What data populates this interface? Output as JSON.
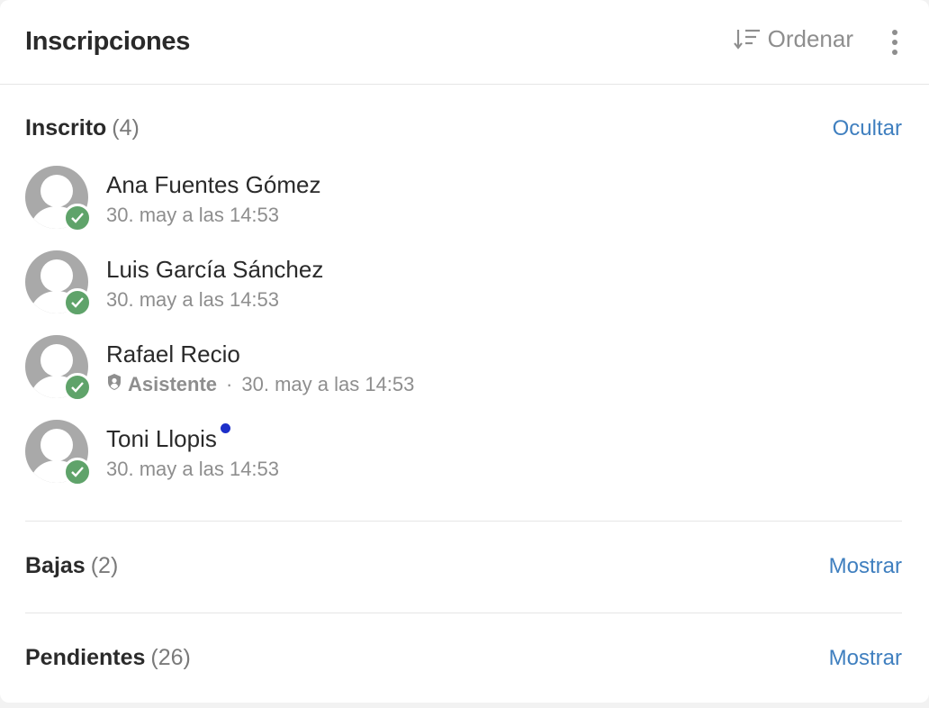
{
  "header": {
    "title": "Inscripciones",
    "sort_label": "Ordenar",
    "sort_icon": "sort-descending-icon",
    "menu_icon": "more-vertical-icon"
  },
  "sections": {
    "enrolled": {
      "title": "Inscrito",
      "count": "(4)",
      "action": "Ocultar",
      "members": [
        {
          "name": "Ana Fuentes Gómez",
          "date": "30. may a las 14:53"
        },
        {
          "name": "Luis García Sánchez",
          "date": "30. may a las 14:53"
        },
        {
          "name": "Rafael Recio",
          "role": "Asistente",
          "separator": "·",
          "date": "30. may a las 14:53"
        },
        {
          "name": "Toni Llopis",
          "date": "30. may a las 14:53"
        }
      ]
    },
    "dropped": {
      "title": "Bajas",
      "count": "(2)",
      "action": "Mostrar"
    },
    "pending": {
      "title": "Pendientes",
      "count": "(26)",
      "action": "Mostrar"
    }
  },
  "colors": {
    "accent": "#3f7fbf",
    "check": "#5fa36a",
    "unread": "#1d2fc9",
    "muted": "#8e8e8e"
  }
}
